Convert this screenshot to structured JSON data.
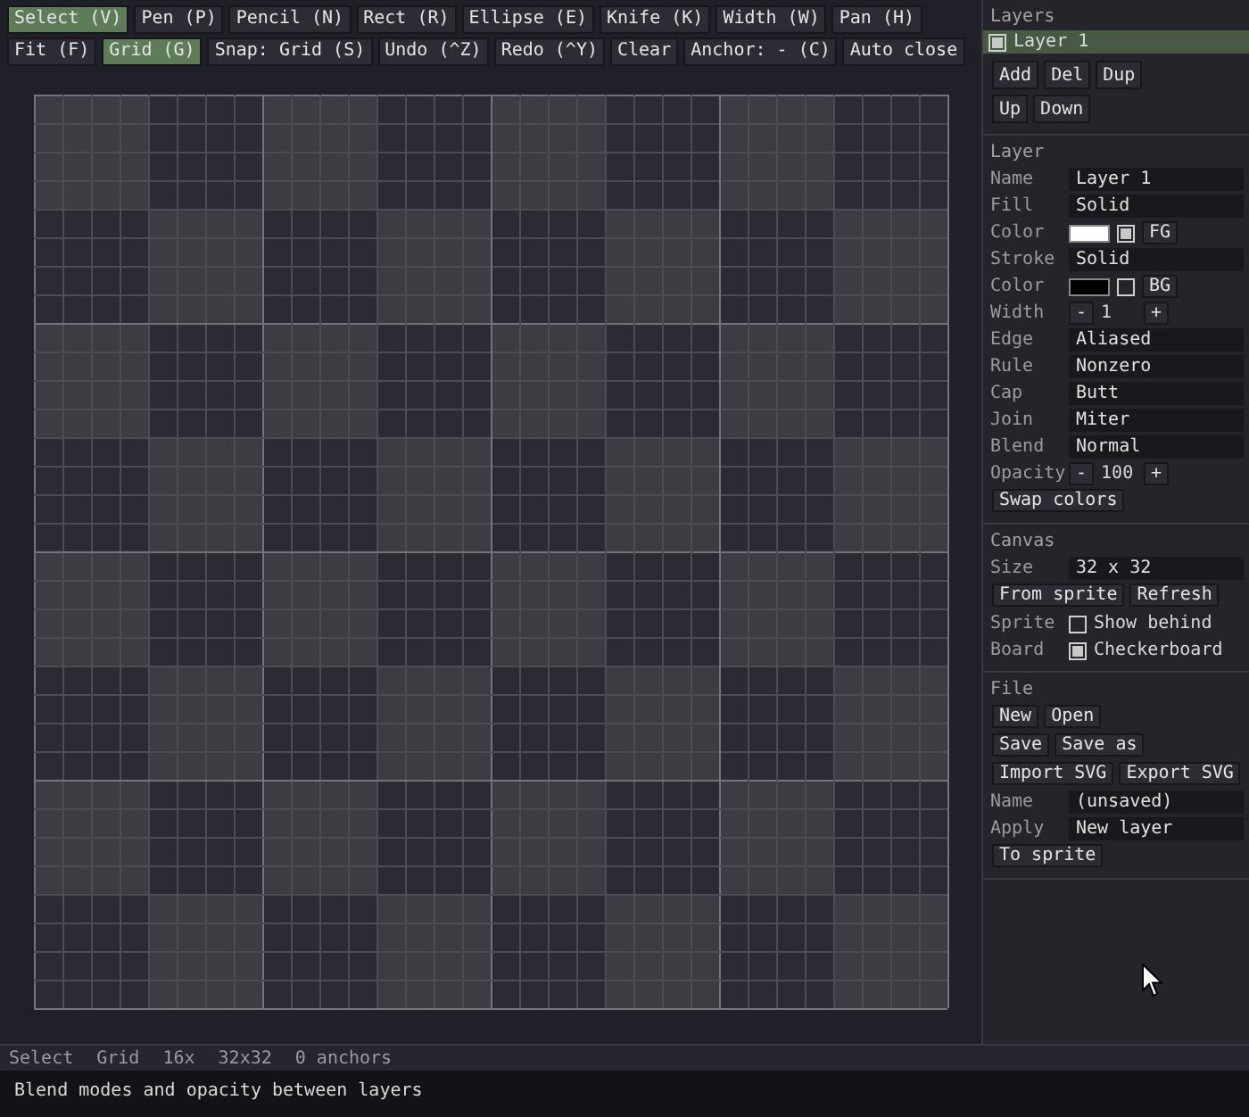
{
  "toolbar": [
    [
      {
        "label": "Select (V)",
        "selected": true
      },
      {
        "label": "Pen (P)",
        "selected": false
      },
      {
        "label": "Pencil (N)",
        "selected": false
      },
      {
        "label": "Rect (R)",
        "selected": false
      },
      {
        "label": "Ellipse (E)",
        "selected": false
      },
      {
        "label": "Knife (K)",
        "selected": false
      },
      {
        "label": "Width (W)",
        "selected": false
      },
      {
        "label": "Pan (H)",
        "selected": false
      }
    ],
    [
      {
        "label": "Fit (F)",
        "selected": false
      },
      {
        "label": "Grid (G)",
        "selected": true
      },
      {
        "label": "Snap: Grid (S)",
        "selected": false
      },
      {
        "label": "Undo (^Z)",
        "selected": false
      },
      {
        "label": "Redo (^Y)",
        "selected": false
      },
      {
        "label": "Clear",
        "selected": false
      },
      {
        "label": "Anchor: - (C)",
        "selected": false
      },
      {
        "label": "Auto close",
        "selected": false
      }
    ]
  ],
  "layers": {
    "title": "Layers",
    "items": [
      {
        "name": "Layer 1",
        "checked": true,
        "selected": true
      }
    ],
    "button_rows": [
      [
        "Add",
        "Del",
        "Dup"
      ],
      [
        "Up",
        "Down"
      ]
    ]
  },
  "sections": [
    {
      "title": "Layer",
      "rows": [
        {
          "kind": "field",
          "label": "Name",
          "value": "Layer 1"
        },
        {
          "kind": "field",
          "label": "Fill",
          "value": "Solid"
        },
        {
          "kind": "color",
          "label": "Color",
          "color": "#ffffff",
          "checked": true,
          "button": "FG"
        },
        {
          "kind": "field",
          "label": "Stroke",
          "value": "Solid"
        },
        {
          "kind": "color",
          "label": "Color",
          "color": "#000000",
          "checked": false,
          "button": "BG"
        },
        {
          "kind": "stepper",
          "label": "Width",
          "minus": "-",
          "value": "1",
          "plus": "+"
        },
        {
          "kind": "field",
          "label": "Edge",
          "value": "Aliased"
        },
        {
          "kind": "field",
          "label": "Rule",
          "value": "Nonzero"
        },
        {
          "kind": "field",
          "label": "Cap",
          "value": "Butt"
        },
        {
          "kind": "field",
          "label": "Join",
          "value": "Miter"
        },
        {
          "kind": "field",
          "label": "Blend",
          "value": "Normal"
        },
        {
          "kind": "stepper",
          "label": "Opacity",
          "minus": "-",
          "value": "100",
          "plus": "+"
        },
        {
          "kind": "buttons",
          "buttons": [
            "Swap colors"
          ]
        }
      ]
    },
    {
      "title": "Canvas",
      "rows": [
        {
          "kind": "field",
          "label": "Size",
          "value": "32 x 32"
        },
        {
          "kind": "buttons",
          "buttons": [
            "From sprite",
            "Refresh"
          ]
        },
        {
          "kind": "check",
          "label": "Sprite",
          "text": "Show behind",
          "checked": false
        },
        {
          "kind": "check",
          "label": "Board",
          "text": "Checkerboard",
          "checked": true
        }
      ]
    },
    {
      "title": "File",
      "rows": [
        {
          "kind": "buttons",
          "buttons": [
            "New",
            "Open"
          ]
        },
        {
          "kind": "buttons",
          "buttons": [
            "Save",
            "Save as"
          ]
        },
        {
          "kind": "buttons",
          "buttons": [
            "Import SVG",
            "Export SVG"
          ]
        },
        {
          "kind": "field",
          "label": "Name",
          "value": "(unsaved)"
        },
        {
          "kind": "field",
          "label": "Apply",
          "value": "New layer"
        },
        {
          "kind": "buttons",
          "buttons": [
            "To sprite"
          ]
        }
      ]
    }
  ],
  "status_bar": [
    "Select",
    "Grid",
    "16x",
    "32x32",
    "0 anchors"
  ],
  "tip": "Blend modes and opacity between layers"
}
